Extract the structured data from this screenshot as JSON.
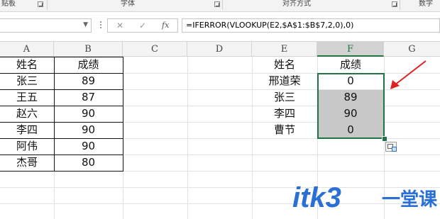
{
  "ribbon": {
    "groups": [
      {
        "label": "贴板"
      },
      {
        "label": "字体"
      },
      {
        "label": "对齐方式"
      },
      {
        "label": "数字"
      }
    ]
  },
  "formula_bar": {
    "namebox_value": "",
    "cancel_icon": "✕",
    "confirm_icon": "✓",
    "fx_label": "fx",
    "formula": "=IFERROR(VLOOKUP(E2,$A$1:$B$7,2,0),0)"
  },
  "columns": [
    "A",
    "B",
    "C",
    "D",
    "E",
    "F",
    "G"
  ],
  "selected_column": "F",
  "table_left": {
    "header": {
      "name": "姓名",
      "score": "成绩"
    },
    "rows": [
      {
        "name": "张三",
        "score": "89"
      },
      {
        "name": "王五",
        "score": "87"
      },
      {
        "name": "赵六",
        "score": "90"
      },
      {
        "name": "李四",
        "score": "90"
      },
      {
        "name": "阿伟",
        "score": "90"
      },
      {
        "name": "杰哥",
        "score": "80"
      }
    ]
  },
  "table_right": {
    "header": {
      "name": "姓名",
      "score": "成绩"
    },
    "rows": [
      {
        "name": "邢道荣",
        "score": "0"
      },
      {
        "name": "张三",
        "score": "89"
      },
      {
        "name": "李四",
        "score": "90"
      },
      {
        "name": "曹节",
        "score": "0"
      }
    ]
  },
  "watermark": {
    "brand": "itk3",
    "tag": "一堂课",
    "brand_color": "#2a6fd6",
    "tag_color": "#2a6fd6"
  },
  "accent": {
    "selection": "#217346",
    "arrow": "#e02020",
    "fill": "#c8c8c8"
  }
}
